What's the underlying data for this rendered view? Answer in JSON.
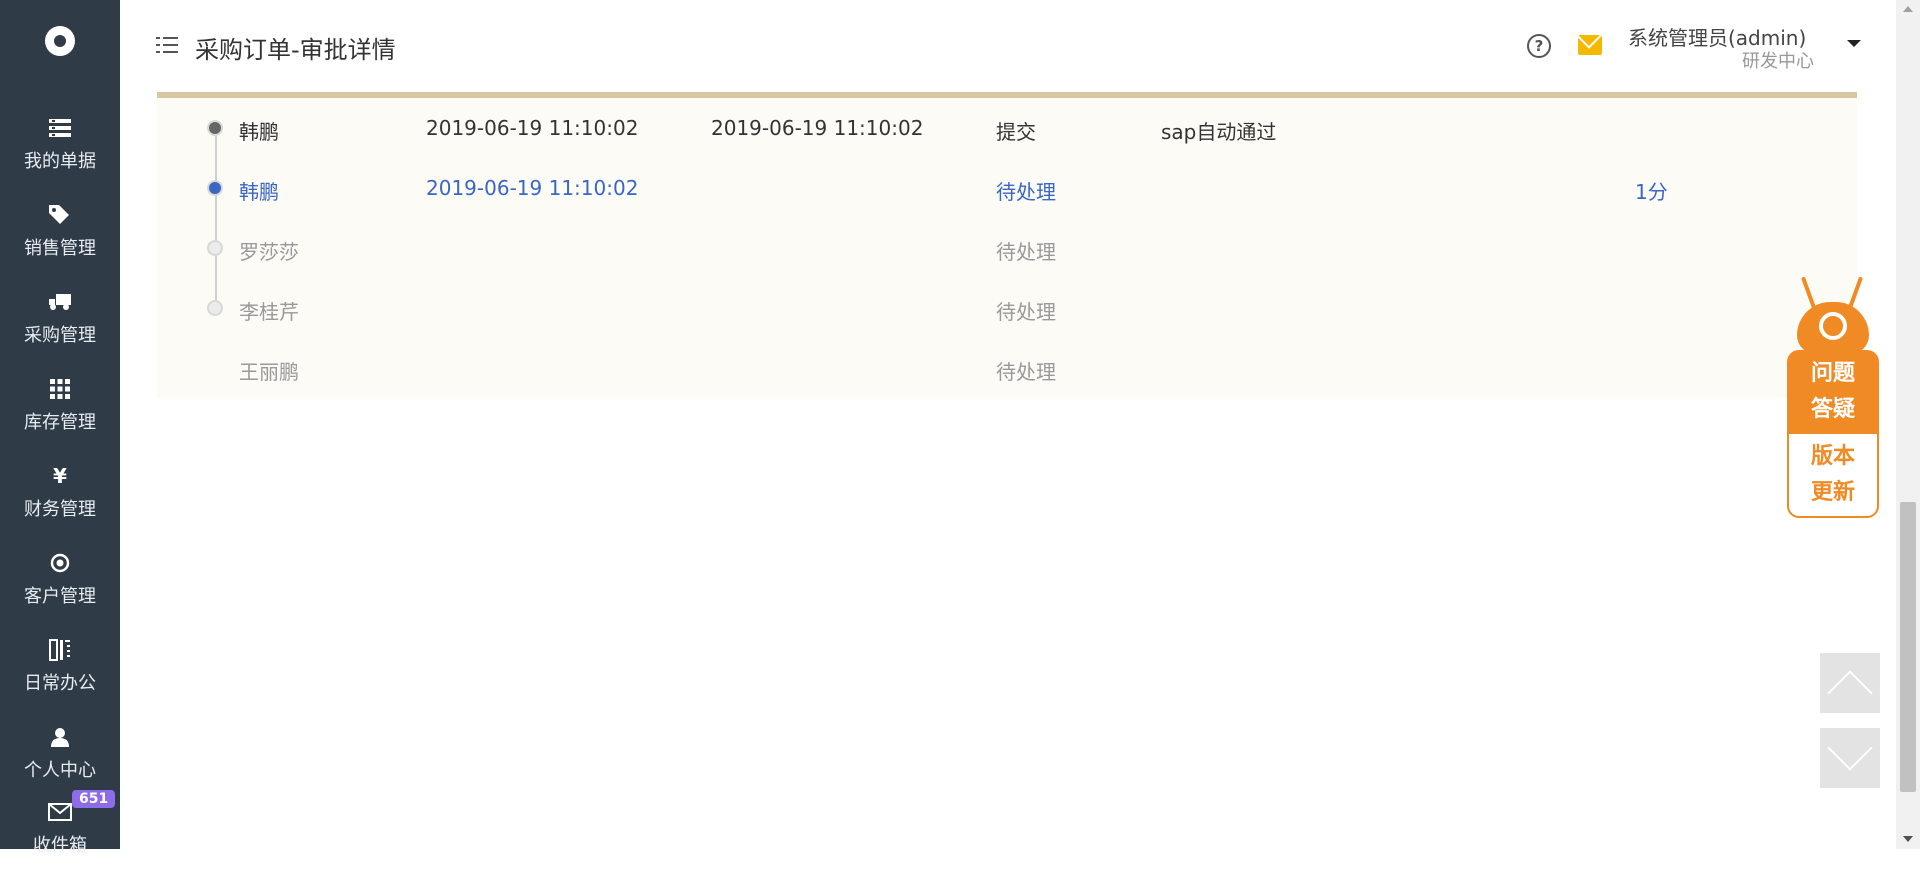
{
  "sidebar": {
    "logo_icon": "gear-logo-icon",
    "items": [
      {
        "label": "我的单据",
        "icon": "document-list-icon"
      },
      {
        "label": "销售管理",
        "icon": "tags-icon"
      },
      {
        "label": "采购管理",
        "icon": "truck-icon"
      },
      {
        "label": "库存管理",
        "icon": "grid-icon"
      },
      {
        "label": "财务管理",
        "icon": "yen-icon"
      },
      {
        "label": "客户管理",
        "icon": "target-icon"
      },
      {
        "label": "日常办公",
        "icon": "columns-icon"
      },
      {
        "label": "个人中心",
        "icon": "user-icon"
      },
      {
        "label": "收件箱",
        "icon": "envelope-icon",
        "badge": "651"
      }
    ]
  },
  "header": {
    "title": "采购订单-审批详情",
    "user_name": "系统管理员(admin)",
    "user_dept": "研发中心",
    "help_icon": "question-circle-icon",
    "mail_icon": "mail-icon",
    "help_glyph": "?"
  },
  "approval": {
    "rows": [
      {
        "name": "韩鹏",
        "arrive_time": "2019-06-19 11:10:02",
        "handle_time": "2019-06-19 11:10:02",
        "status": "提交",
        "comment": "sap自动通过",
        "duration": "",
        "state": "done"
      },
      {
        "name": "韩鹏",
        "arrive_time": "2019-06-19 11:10:02",
        "handle_time": "",
        "status": "待处理",
        "comment": "",
        "duration": "1分",
        "state": "active"
      },
      {
        "name": "罗莎莎",
        "arrive_time": "",
        "handle_time": "",
        "status": "待处理",
        "comment": "",
        "duration": "",
        "state": "pending"
      },
      {
        "name": "李桂芹",
        "arrive_time": "",
        "handle_time": "",
        "status": "待处理",
        "comment": "",
        "duration": "",
        "state": "pending"
      },
      {
        "name": "王丽鹏",
        "arrive_time": "",
        "handle_time": "",
        "status": "待处理",
        "comment": "",
        "duration": "",
        "state": "pending"
      }
    ]
  },
  "qa_widget": {
    "top_line1": "问题",
    "top_line2": "答疑",
    "bottom_line1": "版本",
    "bottom_line2": "更新"
  },
  "colors": {
    "sidebar_bg": "#2f3b47",
    "active_blue": "#3a66c4",
    "widget_orange": "#f08a24",
    "content_bg": "#fdfbf6",
    "badge_purple": "#8e6be8"
  }
}
